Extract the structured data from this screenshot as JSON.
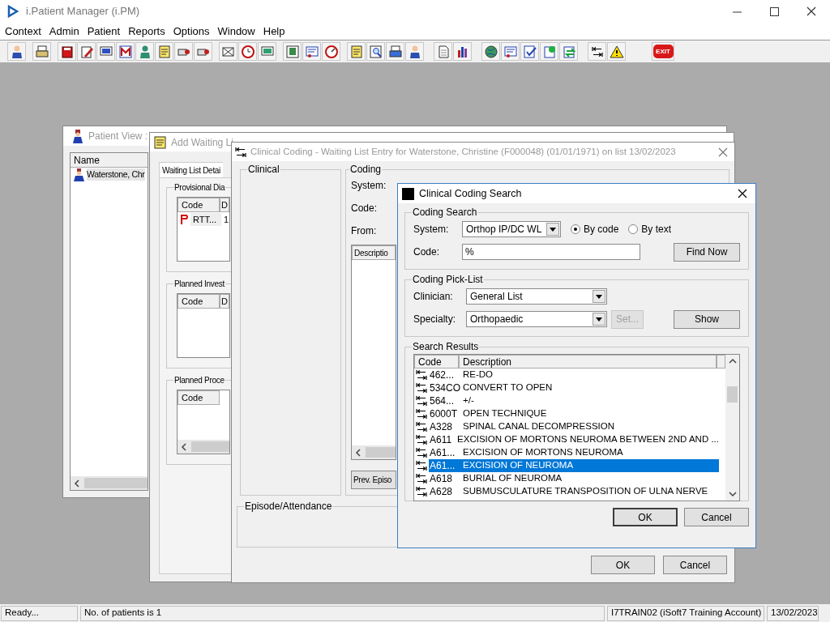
{
  "app": {
    "title": "i.Patient Manager (i.PM)"
  },
  "menu": [
    {
      "label": "Context"
    },
    {
      "label": "Admin"
    },
    {
      "label": "Patient"
    },
    {
      "label": "Reports"
    },
    {
      "label": "Options"
    },
    {
      "label": "Window"
    },
    {
      "label": "Help"
    }
  ],
  "toolbar": {
    "exit_label": "EXIT"
  },
  "patient_view": {
    "title": "Patient View :",
    "columns": [
      "Name"
    ],
    "rows": [
      {
        "name": "Waterstone, Chr",
        "selected": true
      }
    ]
  },
  "waiting_list_entry": {
    "title": "Add Waiting Li",
    "tabs": [
      {
        "label": "Waiting List Detai",
        "selected": true
      }
    ],
    "groups": [
      {
        "title": "Provisional Dia",
        "columns": [
          "Code",
          "D"
        ],
        "rows": [
          {
            "code": "RTT...",
            "column_2": "1"
          }
        ]
      },
      {
        "title": "Planned Invest",
        "columns": [
          "Code",
          "D"
        ]
      },
      {
        "title": "Planned Proce",
        "columns": [
          "Code"
        ]
      }
    ]
  },
  "clinical_coding": {
    "title": "Clinical Coding - Waiting List Entry for Waterstone, Christine (F000048) (01/01/1971) on list 13/02/2023",
    "clinical_group": "Clinical",
    "coding_group": "Coding",
    "fields": [
      "System:",
      "Code:",
      "From:"
    ],
    "list_column": "Descriptio",
    "prev_button": "Prev. Episo",
    "episode_group": "Episode/Attendance",
    "buttons": [
      "OK",
      "Cancel"
    ]
  },
  "search_dialog": {
    "title": "Clinical Coding Search",
    "coding_search": {
      "title": "Coding Search",
      "system_label": "System:",
      "system_value": "Orthop IP/DC WL",
      "modes": [
        {
          "label": "By code",
          "selected": true
        },
        {
          "label": "By text",
          "selected": false
        }
      ],
      "code_label": "Code:",
      "code_value": "%",
      "find_button": "Find Now"
    },
    "pick_list": {
      "title": "Coding Pick-List",
      "clinician_label": "Clinician:",
      "clinician_value": "General List",
      "specialty_label": "Specialty:",
      "specialty_value": "Orthopaedic",
      "set_button": {
        "label": "Set...",
        "disabled": true
      },
      "show_button": "Show"
    },
    "results": {
      "title": "Search Results",
      "columns": [
        "Code",
        "Description"
      ],
      "rows": [
        {
          "code": "462...",
          "description": "RE-DO",
          "selected": false
        },
        {
          "code": "534CO",
          "description": "CONVERT TO OPEN",
          "selected": false
        },
        {
          "code": "564...",
          "description": "+/-",
          "selected": false
        },
        {
          "code": "6000T",
          "description": "OPEN TECHNIQUE",
          "selected": false
        },
        {
          "code": "A328",
          "description": "SPINAL CANAL DECOMPRESSION",
          "selected": false
        },
        {
          "code": "A611",
          "description": "EXCISION OF MORTONS NEUROMA BETWEEN 2ND AND ...",
          "selected": false
        },
        {
          "code": "A61...",
          "description": "EXCISION OF MORTONS NEUROMA",
          "selected": false
        },
        {
          "code": "A61...",
          "description": "EXCISION OF NEUROMA",
          "selected": true
        },
        {
          "code": "A618",
          "description": "BURIAL OF NEUROMA",
          "selected": false
        },
        {
          "code": "A628",
          "description": "SUBMUSCULATURE TRANSPOSITION OF ULNA NERVE",
          "selected": false
        }
      ]
    },
    "buttons": [
      "OK",
      "Cancel"
    ]
  },
  "status_bar": [
    "Ready...",
    "No. of patients is 1",
    "I7TRAIN02 (iSoft7 Training Account)",
    "13/02/2023"
  ]
}
